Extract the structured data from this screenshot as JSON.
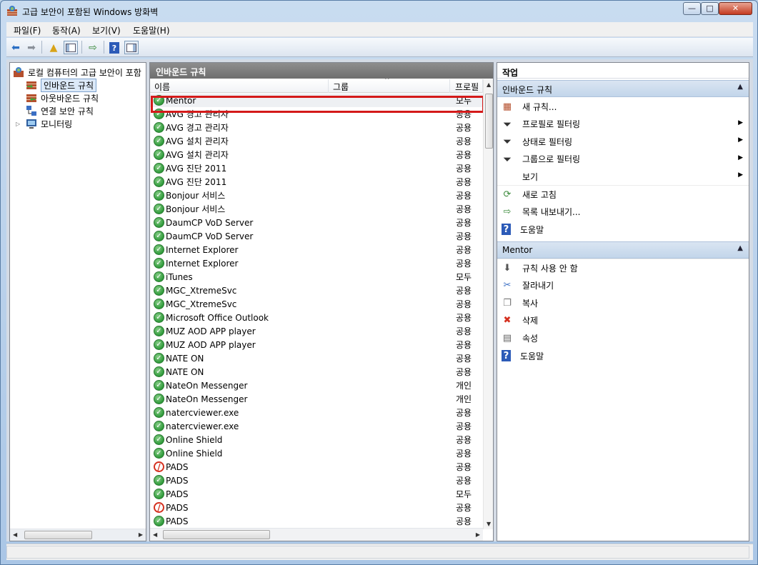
{
  "window": {
    "title": "고급 보안이 포함된 Windows 방화벽",
    "minimize": "—",
    "maximize": "□",
    "close": "✕"
  },
  "menu": [
    "파일(F)",
    "동작(A)",
    "보기(V)",
    "도움말(H)"
  ],
  "tree": {
    "root": "로컬 컴퓨터의 고급 보안이 포함",
    "items": [
      {
        "label": "인바운드 규칙",
        "selected": true
      },
      {
        "label": "아웃바운드 규칙"
      },
      {
        "label": "연결 보안 규칙"
      },
      {
        "label": "모니터링",
        "expander": "▷"
      }
    ]
  },
  "list": {
    "header": "인바운드 규칙",
    "columns": [
      "이름",
      "그룹",
      "프로필"
    ],
    "rows": [
      {
        "name": "Mentor",
        "profile": "모두",
        "status": "ok"
      },
      {
        "name": "AVG 경고 관리자",
        "profile": "공용",
        "status": "ok"
      },
      {
        "name": "AVG 경고 관리자",
        "profile": "공용",
        "status": "ok"
      },
      {
        "name": "AVG 설치 관리자",
        "profile": "공용",
        "status": "ok"
      },
      {
        "name": "AVG 설치 관리자",
        "profile": "공용",
        "status": "ok"
      },
      {
        "name": "AVG 진단 2011",
        "profile": "공용",
        "status": "ok"
      },
      {
        "name": "AVG 진단 2011",
        "profile": "공용",
        "status": "ok"
      },
      {
        "name": "Bonjour 서비스",
        "profile": "공용",
        "status": "ok"
      },
      {
        "name": "Bonjour 서비스",
        "profile": "공용",
        "status": "ok"
      },
      {
        "name": "DaumCP VoD Server",
        "profile": "공용",
        "status": "ok"
      },
      {
        "name": "DaumCP VoD Server",
        "profile": "공용",
        "status": "ok"
      },
      {
        "name": "Internet Explorer",
        "profile": "공용",
        "status": "ok"
      },
      {
        "name": "Internet Explorer",
        "profile": "공용",
        "status": "ok"
      },
      {
        "name": "iTunes",
        "profile": "모두",
        "status": "ok"
      },
      {
        "name": "MGC_XtremeSvc",
        "profile": "공용",
        "status": "ok"
      },
      {
        "name": "MGC_XtremeSvc",
        "profile": "공용",
        "status": "ok"
      },
      {
        "name": "Microsoft Office Outlook",
        "profile": "공용",
        "status": "ok"
      },
      {
        "name": "MUZ AOD APP player",
        "profile": "공용",
        "status": "ok"
      },
      {
        "name": "MUZ AOD APP player",
        "profile": "공용",
        "status": "ok"
      },
      {
        "name": "NATE ON",
        "profile": "공용",
        "status": "ok"
      },
      {
        "name": "NATE ON",
        "profile": "공용",
        "status": "ok"
      },
      {
        "name": "NateOn Messenger",
        "profile": "개인",
        "status": "ok"
      },
      {
        "name": "NateOn Messenger",
        "profile": "개인",
        "status": "ok"
      },
      {
        "name": "natercviewer.exe",
        "profile": "공용",
        "status": "ok"
      },
      {
        "name": "natercviewer.exe",
        "profile": "공용",
        "status": "ok"
      },
      {
        "name": "Online Shield",
        "profile": "공용",
        "status": "ok"
      },
      {
        "name": "Online Shield",
        "profile": "공용",
        "status": "ok"
      },
      {
        "name": "PADS",
        "profile": "공용",
        "status": "block"
      },
      {
        "name": "PADS",
        "profile": "공용",
        "status": "ok"
      },
      {
        "name": "PADS",
        "profile": "모두",
        "status": "ok"
      },
      {
        "name": "PADS",
        "profile": "공용",
        "status": "block"
      },
      {
        "name": "PADS",
        "profile": "공용",
        "status": "ok"
      }
    ]
  },
  "actions": {
    "title": "작업",
    "group1": {
      "label": "인바운드 규칙",
      "items": [
        {
          "label": "새 규칙...",
          "icon": "new-rule-icon"
        },
        {
          "label": "프로필로 필터링",
          "icon": "filter-icon",
          "submenu": true
        },
        {
          "label": "상태로 필터링",
          "icon": "filter-icon",
          "submenu": true
        },
        {
          "label": "그룹으로 필터링",
          "icon": "filter-icon",
          "submenu": true
        },
        {
          "label": "보기",
          "icon": "",
          "submenu": true
        },
        {
          "label": "새로 고침",
          "icon": "refresh-icon"
        },
        {
          "label": "목록 내보내기...",
          "icon": "export-icon"
        },
        {
          "label": "도움말",
          "icon": "help-icon"
        }
      ]
    },
    "group2": {
      "label": "Mentor",
      "items": [
        {
          "label": "규칙 사용 안 함",
          "icon": "disable-icon"
        },
        {
          "label": "잘라내기",
          "icon": "cut-icon"
        },
        {
          "label": "복사",
          "icon": "copy-icon"
        },
        {
          "label": "삭제",
          "icon": "delete-icon"
        },
        {
          "label": "속성",
          "icon": "properties-icon"
        },
        {
          "label": "도움말",
          "icon": "help-icon"
        }
      ]
    }
  },
  "colors": {
    "highlight_border": "#d41a1a",
    "ok_icon": "#2f9a3a",
    "block_icon": "#d5301f"
  }
}
